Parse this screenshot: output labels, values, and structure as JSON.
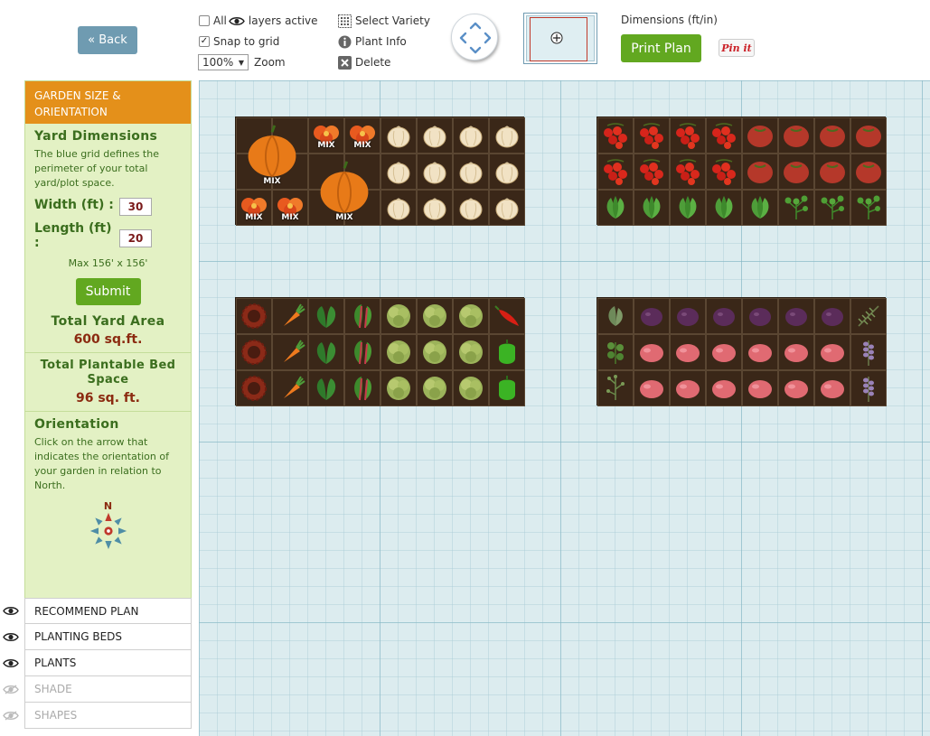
{
  "toolbar": {
    "back_label": "« Back",
    "all_label": "All",
    "layers_active_label": "layers active",
    "snap_label": "Snap to grid",
    "zoom_value": "100%",
    "zoom_label": "Zoom",
    "select_variety_label": "Select Variety",
    "plant_info_label": "Plant Info",
    "delete_label": "Delete",
    "dimensions_label": "Dimensions (ft/in)",
    "print_label": "Print Plan",
    "pin_label": "Pin it"
  },
  "sidebar": {
    "header": "Garden Size & Orientation",
    "yard_title": "Yard Dimensions",
    "yard_text": "The blue grid defines the perimeter of your total yard/plot space.",
    "width_label": "Width (ft) :",
    "width_value": "30",
    "length_label": "Length (ft) :",
    "length_value": "20",
    "max_note": "Max 156' x 156'",
    "submit_label": "Submit",
    "total_yard_title": "Total Yard Area",
    "total_yard_value": "600 sq.ft.",
    "plantable_title": "Total Plantable Bed Space",
    "plantable_value": "96 sq. ft.",
    "orientation_title": "Orientation",
    "orientation_text": "Click on the arrow that indicates the orientation of your garden in relation to North.",
    "compass_n": "N"
  },
  "layers": [
    {
      "label": "Recommend Plan",
      "visible": true
    },
    {
      "label": "Planting Beds",
      "visible": true
    },
    {
      "label": "Plants",
      "visible": true
    },
    {
      "label": "Shade",
      "visible": false
    },
    {
      "label": "Shapes",
      "visible": false
    }
  ],
  "mix_label": "MIX",
  "beds": [
    {
      "name": "bed-1",
      "cells": [
        [
          "big-pumpkin",
          "big-pumpkin",
          "nasturtium-mix",
          "nasturtium-mix",
          "onion",
          "onion",
          "onion",
          "onion"
        ],
        [
          "big-pumpkin",
          "big-pumpkin",
          "big-pumpkin2",
          "big-pumpkin2",
          "onion",
          "onion",
          "onion",
          "onion"
        ],
        [
          "nasturtium-mix",
          "nasturtium-mix",
          "big-pumpkin2",
          "big-pumpkin2",
          "onion",
          "onion",
          "onion",
          "onion"
        ]
      ]
    },
    {
      "name": "bed-2",
      "cells": [
        [
          "cherry-tomato",
          "cherry-tomato",
          "cherry-tomato",
          "cherry-tomato",
          "heirloom-tomato",
          "heirloom-tomato",
          "heirloom-tomato",
          "heirloom-tomato"
        ],
        [
          "cherry-tomato",
          "cherry-tomato",
          "cherry-tomato",
          "cherry-tomato",
          "heirloom-tomato",
          "heirloom-tomato",
          "heirloom-tomato",
          "heirloom-tomato"
        ],
        [
          "basil",
          "basil",
          "basil",
          "basil",
          "basil",
          "parsley",
          "parsley",
          "parsley"
        ]
      ]
    },
    {
      "name": "bed-3",
      "cells": [
        [
          "sunflower",
          "carrot",
          "spinach",
          "chard",
          "lettuce",
          "lettuce",
          "lettuce",
          "chili-pepper"
        ],
        [
          "sunflower",
          "carrot",
          "spinach",
          "chard",
          "lettuce",
          "lettuce",
          "lettuce",
          "bell-pepper"
        ],
        [
          "sunflower",
          "carrot",
          "spinach",
          "chard",
          "lettuce",
          "lettuce",
          "lettuce",
          "bell-pepper"
        ]
      ]
    },
    {
      "name": "bed-4",
      "cells": [
        [
          "sage",
          "purple-potato",
          "purple-potato",
          "purple-potato",
          "purple-potato",
          "purple-potato",
          "purple-potato",
          "rosemary"
        ],
        [
          "oregano",
          "red-potato",
          "red-potato",
          "red-potato",
          "red-potato",
          "red-potato",
          "red-potato",
          "lavender"
        ],
        [
          "thyme",
          "red-potato",
          "red-potato",
          "red-potato",
          "red-potato",
          "red-potato",
          "red-potato",
          "lavender"
        ]
      ]
    }
  ],
  "colors": {
    "accent_orange": "#e4901a",
    "green_button": "#62a820",
    "back_blue": "#6f9bb1",
    "sidebar_green": "#e3f1c4",
    "text_green": "#3b6e1e",
    "value_red": "#8b2a10",
    "grid_bg": "#dcecef",
    "soil": "#3a2718"
  }
}
